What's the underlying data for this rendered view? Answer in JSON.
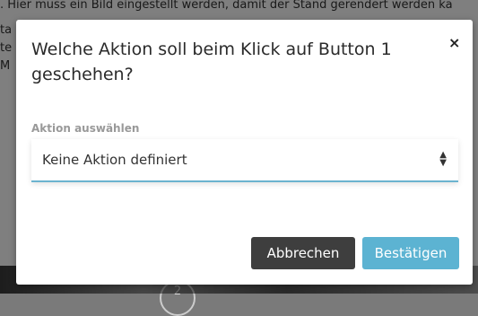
{
  "background": {
    "text_line": ". Hier muss ein Bild eingestellt werden, damit der Stand gerendert werden ka",
    "fragments": [
      "ta",
      "te",
      "M"
    ],
    "badge": "2"
  },
  "modal": {
    "title": "Welche Aktion soll beim Klick auf Button 1 geschehen?",
    "close_glyph": "×",
    "select_label": "Aktion auswählen",
    "select_value": "Keine Aktion definiert",
    "cancel_label": "Abbrechen",
    "confirm_label": "Bestätigen"
  },
  "colors": {
    "accent": "#5cb3d2",
    "cancel": "#3e3e3e",
    "overlay": "rgba(0,0,0,0.5)"
  }
}
